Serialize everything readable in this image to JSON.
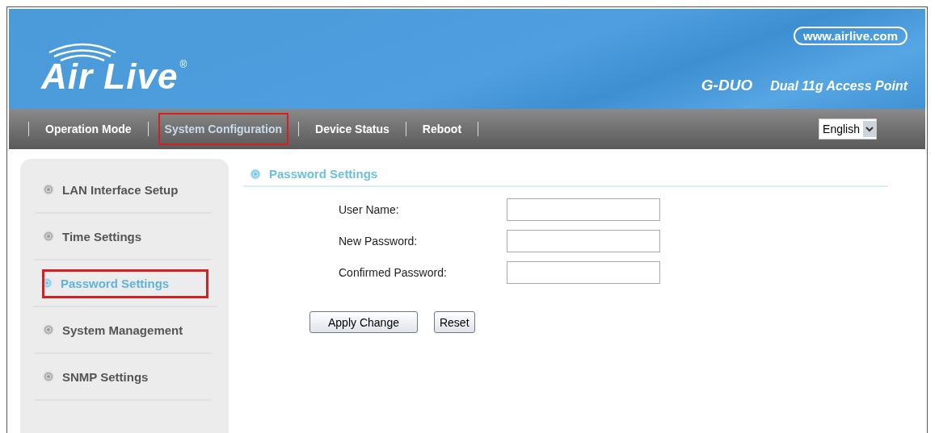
{
  "header": {
    "logo": "Air Live",
    "registered": "®",
    "website": "www.airlive.com",
    "model": "G-DUO",
    "product": "Dual 11g Access Point"
  },
  "nav": [
    {
      "label": "Operation Mode",
      "selected": false
    },
    {
      "label": "System Configuration",
      "selected": true
    },
    {
      "label": "Device Status",
      "selected": false
    },
    {
      "label": "Reboot",
      "selected": false
    }
  ],
  "language": {
    "value": "English"
  },
  "sidebar": {
    "items": [
      {
        "label": "LAN Interface Setup",
        "selected": false
      },
      {
        "label": "Time Settings",
        "selected": false
      },
      {
        "label": "Password Settings",
        "selected": true
      },
      {
        "label": "System Management",
        "selected": false
      },
      {
        "label": "SNMP Settings",
        "selected": false
      }
    ]
  },
  "section": {
    "title": "Password Settings",
    "fields": [
      {
        "label": "User Name:"
      },
      {
        "label": "New Password:"
      },
      {
        "label": "Confirmed Password:"
      }
    ],
    "buttons": [
      "Apply Change",
      "Reset"
    ]
  }
}
